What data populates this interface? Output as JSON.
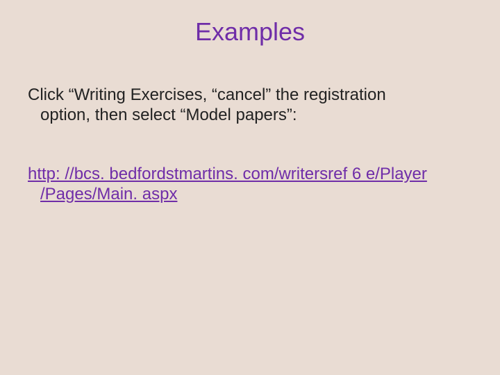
{
  "title": "Examples",
  "body": {
    "line1": "Click “Writing Exercises, “cancel” the registration",
    "line2": "option, then select “Model papers”:"
  },
  "link": {
    "line1": "http: //bcs. bedfordstmartins. com/writersref 6 e/Player",
    "line2": "/Pages/Main. aspx"
  }
}
